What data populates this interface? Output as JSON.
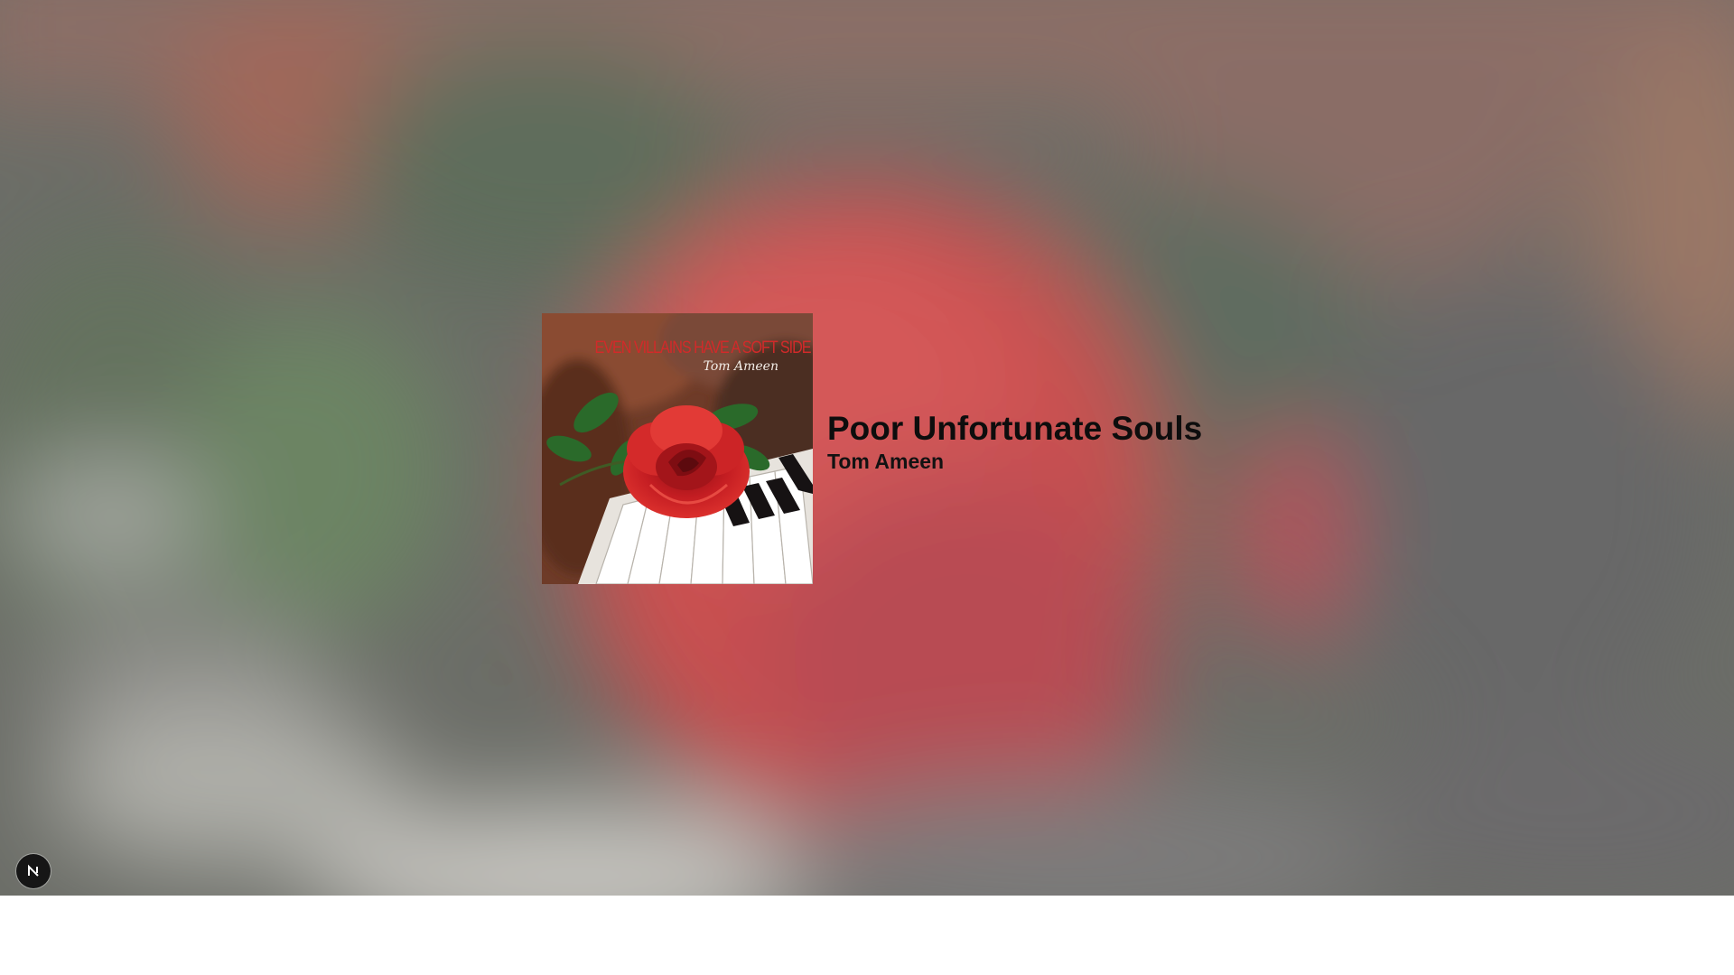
{
  "now_playing": {
    "track_title": "Poor Unfortunate Souls",
    "artist": "Tom Ameen"
  },
  "album_cover": {
    "title_text": "EVEN VILLAINS HAVE A SOFT SIDE",
    "artist_text": "Tom Ameen"
  },
  "dev_badge": {
    "icon": "nextjs-logo-icon"
  },
  "colors": {
    "rose_red": "#c8262a",
    "backdrop_green": "#5f7060",
    "backdrop_gray": "#6a6c66"
  }
}
